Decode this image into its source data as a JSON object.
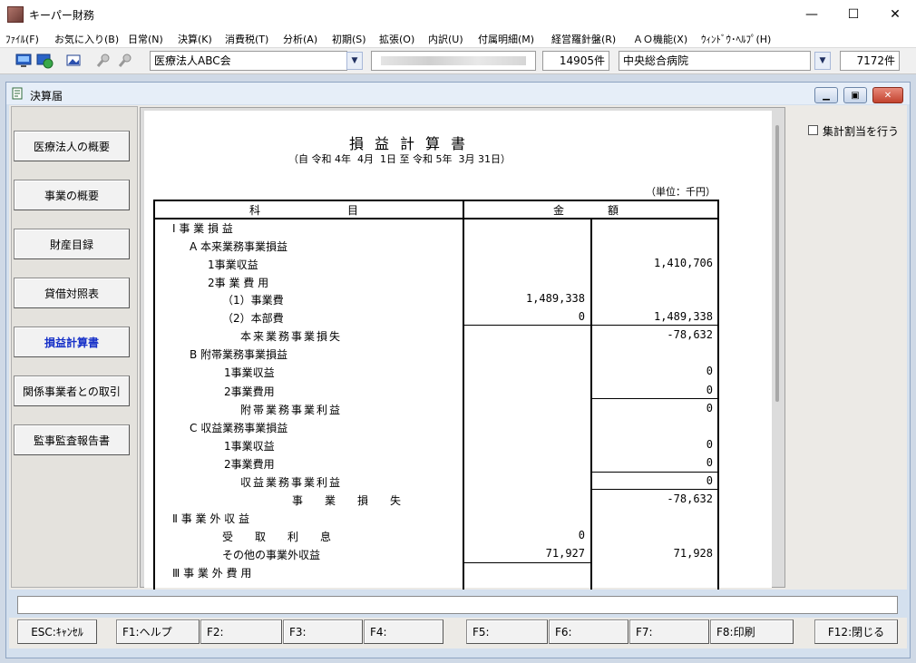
{
  "app": {
    "title": "キーパー財務"
  },
  "window_controls": {
    "minimize": "—",
    "maximize": "☐",
    "close": "✕"
  },
  "menu": [
    "ﾌｧｲﾙ(F)",
    "お気に入り(B)",
    "日常(N)",
    "決算(K)",
    "消費税(T)",
    "分析(A)",
    "初期(S)",
    "拡張(O)",
    "内訳(U)",
    "付属明細(M)",
    "経営羅針盤(R)",
    "ＡＯ機能(X)",
    "ｳｨﾝﾄﾞｳ･ﾍﾙﾌﾟ(H)"
  ],
  "toolbar": {
    "company": "医療法人ABC会",
    "company_count": "14905件",
    "client": "中央総合病院",
    "client_count": "7172件"
  },
  "child_window": {
    "title": "決算届"
  },
  "nav": [
    {
      "label": "医療法人の概要",
      "active": false
    },
    {
      "label": "事業の概要",
      "active": false
    },
    {
      "label": "財産目録",
      "active": false
    },
    {
      "label": "貸借対照表",
      "active": false
    },
    {
      "label": "損益計算書",
      "active": true
    },
    {
      "label": "関係事業者との取引",
      "active": false
    },
    {
      "label": "監事監査報告書",
      "active": false
    }
  ],
  "option": {
    "label": "集計割当を行う",
    "checked": false
  },
  "statement": {
    "title": "損益計算書",
    "period": "（自 令和 4年  4月  1日 至 令和 5年  3月 31日）",
    "unit": "（単位：千円）",
    "header_item": "科　　　　　　　　目",
    "header_amount": "金　　　　額",
    "rows": [
      {
        "label": "Ⅰ 事 業 損 益",
        "inner": "",
        "outer": ""
      },
      {
        "label": "A 本来業務事業損益",
        "inner": "",
        "outer": ""
      },
      {
        "label": "1事業収益",
        "inner": "",
        "outer": "1,410,706"
      },
      {
        "label": "2事 業 費 用",
        "inner": "",
        "outer": ""
      },
      {
        "label": "（1）事業費",
        "inner": "1,489,338",
        "outer": ""
      },
      {
        "label": "（2）本部費",
        "inner": "0",
        "outer": "1,489,338"
      },
      {
        "label": "本来業務事業損失",
        "inner": "",
        "outer": "-78,632"
      },
      {
        "label": "B 附帯業務事業損益",
        "inner": "",
        "outer": ""
      },
      {
        "label": "1事業収益",
        "inner": "",
        "outer": "0"
      },
      {
        "label": "2事業費用",
        "inner": "",
        "outer": "0"
      },
      {
        "label": "附帯業務事業利益",
        "inner": "",
        "outer": "0"
      },
      {
        "label": "C 収益業務事業損益",
        "inner": "",
        "outer": ""
      },
      {
        "label": "1事業収益",
        "inner": "",
        "outer": "0"
      },
      {
        "label": "2事業費用",
        "inner": "",
        "outer": "0"
      },
      {
        "label": "収益業務事業利益",
        "inner": "",
        "outer": "0"
      },
      {
        "label": "事　　業　　損　　失",
        "inner": "",
        "outer": "-78,632"
      },
      {
        "label": "Ⅱ 事 業 外 収 益",
        "inner": "",
        "outer": ""
      },
      {
        "label": "受　　取　　利　　息",
        "inner": "0",
        "outer": ""
      },
      {
        "label": "その他の事業外収益",
        "inner": "71,927",
        "outer": "71,928"
      },
      {
        "label": "Ⅲ 事 業 外 費 用",
        "inner": "",
        "outer": ""
      }
    ]
  },
  "status": {
    "text": ""
  },
  "fkeys": [
    {
      "label": "ESC:ｷｬﾝｾﾙ"
    },
    {
      "label": "F1:ヘルプ"
    },
    {
      "label": "F2:"
    },
    {
      "label": "F3:"
    },
    {
      "label": "F4:"
    },
    {
      "label": "F5:"
    },
    {
      "label": "F6:"
    },
    {
      "label": "F7:"
    },
    {
      "label": "F8:印刷"
    },
    {
      "label": "F12:閉じる"
    }
  ]
}
